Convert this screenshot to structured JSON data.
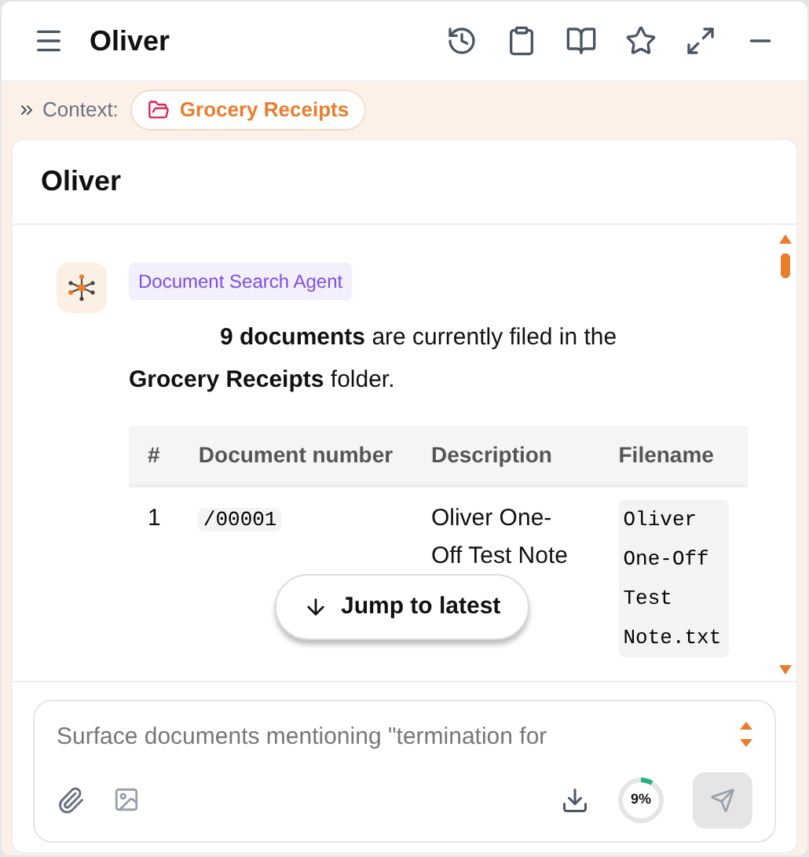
{
  "app_bar": {
    "title": "Oliver"
  },
  "context": {
    "label": "Context:",
    "folder": "Grocery Receipts"
  },
  "chat": {
    "title": "Oliver",
    "message": {
      "agent": "Document Search Agent",
      "text": "**9 documents** are currently filed in the **Grocery Receipts** folder.",
      "table": {
        "columns": [
          "#",
          "Document number",
          "Description",
          "Filename"
        ],
        "rows": [
          {
            "cells": [
              "1",
              "/00001",
              "Oliver One-Off Test Note",
              "Oliver One-Off Test Note.txt"
            ]
          }
        ]
      }
    },
    "jump_button": "Jump to latest"
  },
  "composer": {
    "placeholder": "Surface documents mentioning \"termination for",
    "usage": {
      "level": 0.09,
      "reading": "9%"
    }
  }
}
